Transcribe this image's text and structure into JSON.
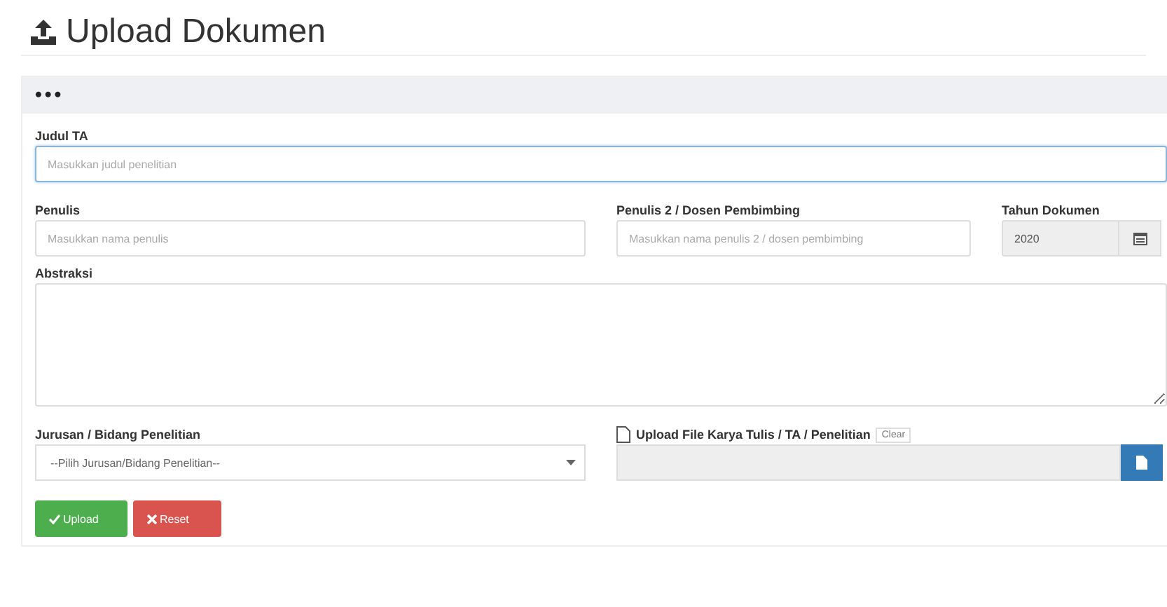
{
  "page": {
    "title": "Upload Dokumen"
  },
  "panel": {
    "header": "•••"
  },
  "fields": {
    "judul": {
      "label": "Judul TA",
      "placeholder": "Masukkan judul penelitian",
      "focused": true
    },
    "penulis": {
      "label": "Penulis",
      "placeholder": "Masukkan nama penulis",
      "focused": false
    },
    "penulis2": {
      "label": "Penulis 2 / Dosen Pembimbing",
      "placeholder": "Masukkan nama penulis 2 / dosen pembimbing",
      "focused": false
    },
    "tahun": {
      "label": "Tahun Dokumen",
      "value": "2020",
      "disabled": true
    },
    "abstraksi": {
      "label": "Abstraksi"
    },
    "jurusan": {
      "label": "Jurusan / Bidang Penelitian",
      "value": "--Pilih Jurusan/Bidang Penelitian--"
    },
    "file": {
      "label": "Upload File Karya Tulis / TA / Penelitian",
      "clear": "Clear"
    }
  },
  "buttons": [
    {
      "label": "Upload",
      "kind": "success"
    },
    {
      "label": "Reset",
      "kind": "danger"
    }
  ]
}
